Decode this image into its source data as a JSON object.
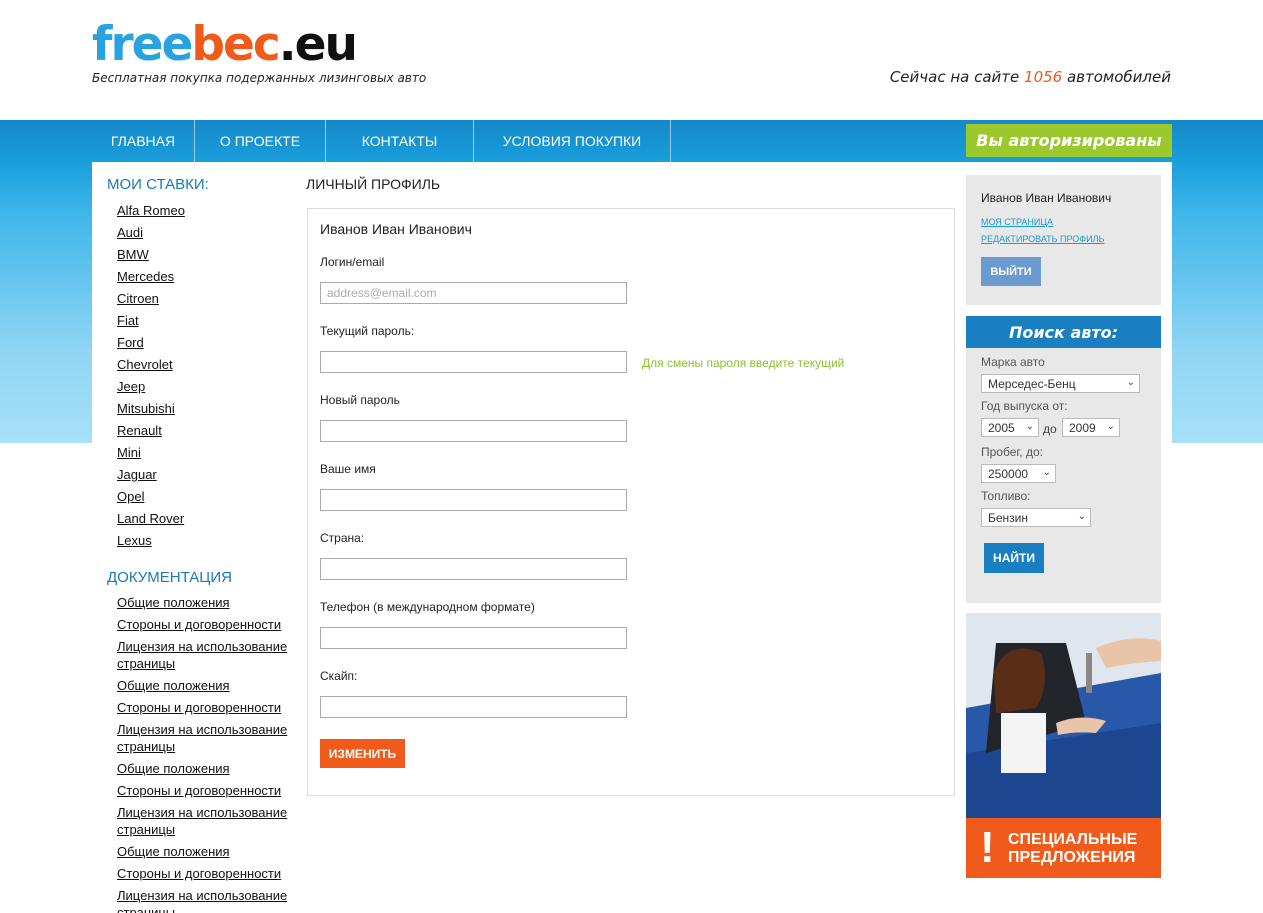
{
  "header": {
    "logo": {
      "part1": "free",
      "part2": "bec",
      "part3": ".eu"
    },
    "tagline": "Бесплатная покупка подержанных лизинговых авто",
    "site_count_prefix": "Сейчас на сайте ",
    "site_count_number": "1056",
    "site_count_suffix": " автомобилей"
  },
  "nav": {
    "items": [
      {
        "label": "Главная"
      },
      {
        "label": "О проекте"
      },
      {
        "label": "Контакты"
      },
      {
        "label": "Условия покупки"
      }
    ],
    "auth_status": "Вы авторизированы"
  },
  "sidebar": {
    "bids_title": "Мои ставки:",
    "brands": [
      "Alfa Romeo",
      "Audi",
      "BMW",
      "Mercedes",
      "Citroen",
      "Fiat",
      "Ford",
      "Chevrolet",
      "Jeep",
      "Mitsubishi",
      "Renault",
      "Mini",
      "Jaguar",
      "Opel",
      "Land Rover",
      "Lexus"
    ],
    "docs_title": "Документация",
    "docs": [
      "Общие положения",
      "Стороны и договоренности",
      "Лицензия на использование страницы",
      "Общие положения",
      "Стороны и договоренности",
      "Лицензия на использование страницы",
      "Общие положения",
      "Стороны и договоренности",
      "Лицензия на использование страницы",
      "Общие положения",
      "Стороны и договоренности",
      "Лицензия на использование страницы"
    ]
  },
  "profile": {
    "title": "Личный профиль",
    "name": "Иванов Иван Иванович",
    "login_label": "Логин/email",
    "login_placeholder": "address@email.com",
    "current_password_label": "Текущий пароль:",
    "current_password_hint": "Для смены пароля введите текущий",
    "new_password_label": "Новый пароль",
    "your_name_label": "Ваше имя",
    "country_label": "Страна:",
    "phone_label": "Телефон (в международном формате)",
    "skype_label": "Скайп:",
    "submit_label": "Изменить"
  },
  "user_box": {
    "name": "Иванов Иван Иванович",
    "my_page": "Моя страница",
    "edit_profile": "Редактировать профиль",
    "logout": "Выйти"
  },
  "search": {
    "title": "Поиск авто:",
    "brand_label": "Марка авто",
    "brand_value": "Мерседес-Бенц",
    "year_label": "Год выпуска от:",
    "year_from": "2005",
    "year_to_label": "до",
    "year_to": "2009",
    "mileage_label": "Пробег, до:",
    "mileage_value": "250000",
    "fuel_label": "Топливо:",
    "fuel_value": "Бензин",
    "find_label": "Найти"
  },
  "promo": {
    "exclamation": "!",
    "line1": "Специальные",
    "line2": "предложения"
  },
  "colors": {
    "accent_blue": "#1a7fc1",
    "accent_orange": "#f05a1a",
    "accent_green": "#9bc92d"
  }
}
